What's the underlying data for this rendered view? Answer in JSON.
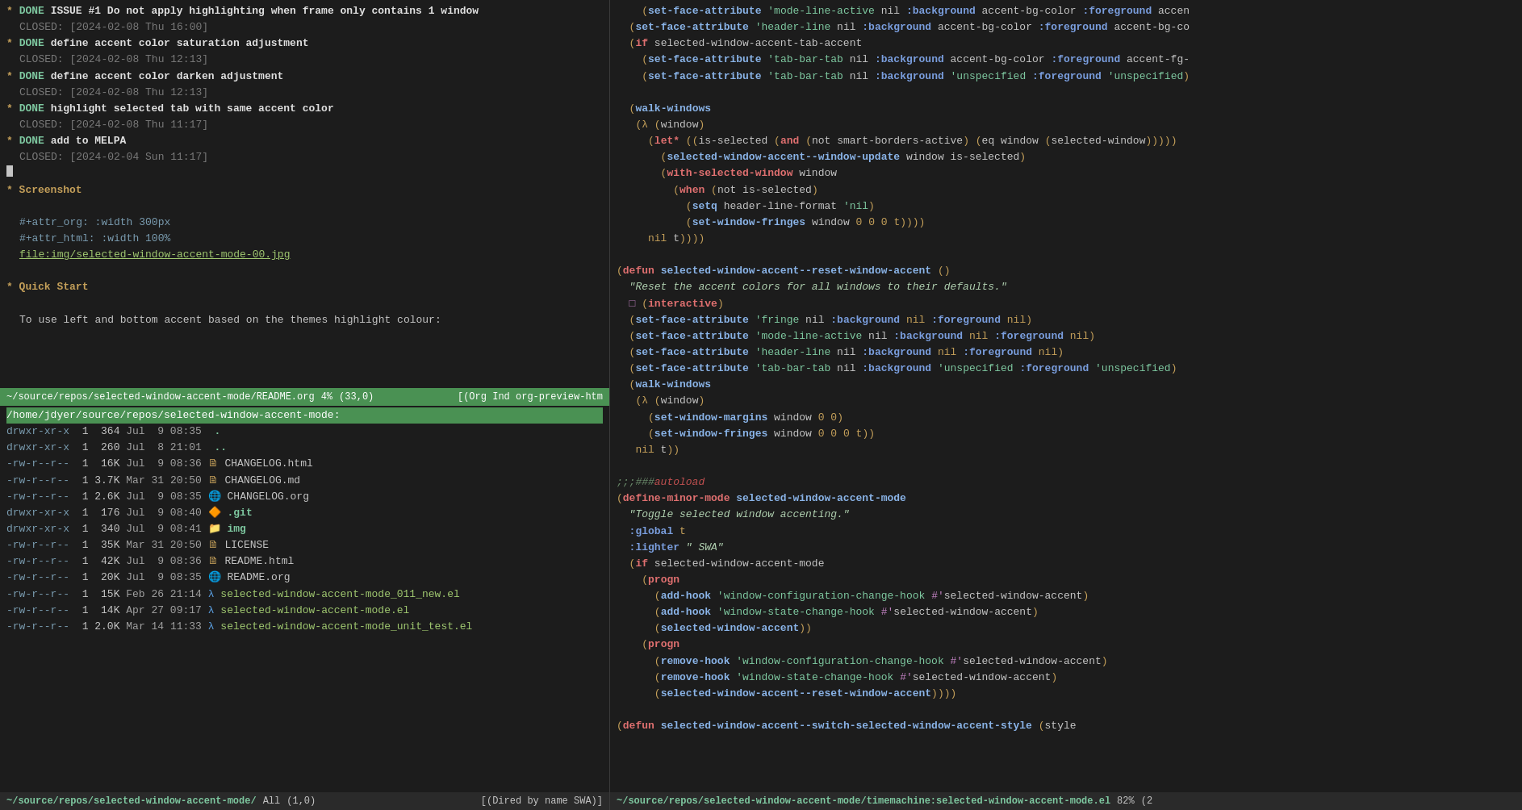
{
  "left_pane": {
    "lines": [
      {
        "type": "todo_done",
        "star": "*",
        "done": "DONE",
        "text": " ISSUE #1 Do not apply highlighting when frame only contains 1 window"
      },
      {
        "type": "closed",
        "text": "  CLOSED: [2024-02-08 Thu 16:00]"
      },
      {
        "type": "todo_done",
        "star": "*",
        "done": "DONE",
        "text": " define accent color saturation adjustment"
      },
      {
        "type": "closed",
        "text": "  CLOSED: [2024-02-08 Thu 12:13]"
      },
      {
        "type": "todo_done",
        "star": "*",
        "done": "DONE",
        "text": " define accent color darken adjustment"
      },
      {
        "type": "closed",
        "text": "  CLOSED: [2024-02-08 Thu 12:13]"
      },
      {
        "type": "todo_done",
        "star": "*",
        "done": "DONE",
        "text": " highlight selected tab with same accent color"
      },
      {
        "type": "closed",
        "text": "  CLOSED: [2024-02-08 Thu 11:17]"
      },
      {
        "type": "todo_done",
        "star": "*",
        "done": "DONE",
        "text": " add to MELPA"
      },
      {
        "type": "closed",
        "text": "  CLOSED: [2024-02-04 Sun 11:17]"
      },
      {
        "type": "cursor"
      },
      {
        "type": "heading",
        "star": "*",
        "text": " Screenshot"
      },
      {
        "type": "blank"
      },
      {
        "type": "attr",
        "text": "  #+attr_org: :width 300px"
      },
      {
        "type": "attr",
        "text": "  #+attr_html: :width 100%"
      },
      {
        "type": "file",
        "text": "  file:img/selected-window-accent-mode-00.jpg"
      },
      {
        "type": "blank"
      },
      {
        "type": "heading",
        "star": "*",
        "text": " Quick Start"
      },
      {
        "type": "blank"
      },
      {
        "type": "text",
        "text": "  To use left and bottom accent based on the themes highlight colour:"
      }
    ],
    "status_bar": {
      "path": "~/source/repos/selected-window-accent-mode/README.org",
      "pct": "4%",
      "pos": "(33,0)",
      "mode": "[(Org Ind org-preview-htm"
    },
    "dired": {
      "path": "/home/jdyer/source/repos/selected-window-accent-mode:",
      "entries": [
        {
          "perms": "drwxr-xr-x",
          "links": "1",
          "size": "364",
          "date": "Jul  9 08:35",
          "icon": "",
          "name": ".",
          "type": "dir"
        },
        {
          "perms": "drwxr-xr-x",
          "links": "1",
          "size": "260",
          "date": "Jul  8 21:01",
          "icon": "",
          "name": "..",
          "type": "dir"
        },
        {
          "perms": "-rw-r--r--",
          "links": "1",
          "size": "16K",
          "date": "Jul  9 08:36",
          "icon": "🗎",
          "name": "CHANGELOG.html",
          "type": "html"
        },
        {
          "perms": "-rw-r--r--",
          "links": "1",
          "size": "3.7K",
          "date": "Mar 31 20:50",
          "icon": "🗎",
          "name": "CHANGELOG.md",
          "type": "md"
        },
        {
          "perms": "-rw-r--r--",
          "links": "1",
          "size": "2.6K",
          "date": "Jul  9 08:35",
          "icon": "🌐",
          "name": "CHANGELOG.org",
          "type": "org"
        },
        {
          "perms": "drwxr-xr-x",
          "links": "1",
          "size": "176",
          "date": "Jul  9 08:40",
          "icon": "🔶",
          "name": ".git",
          "type": "git"
        },
        {
          "perms": "drwxr-xr-x",
          "links": "1",
          "size": "340",
          "date": "Jul  9 08:41",
          "icon": "📁",
          "name": "img",
          "type": "imgdir"
        },
        {
          "perms": "-rw-r--r--",
          "links": "1",
          "size": "35K",
          "date": "Mar 31 20:50",
          "icon": "🗎",
          "name": "LICENSE",
          "type": "file"
        },
        {
          "perms": "-rw-r--r--",
          "links": "1",
          "size": "42K",
          "date": "Jul  9 08:36",
          "icon": "🗎",
          "name": "README.html",
          "type": "html"
        },
        {
          "perms": "-rw-r--r--",
          "links": "1",
          "size": "20K",
          "date": "Jul  9 08:35",
          "icon": "🌐",
          "name": "README.org",
          "type": "org"
        },
        {
          "perms": "-rw-r--r--",
          "links": "1",
          "size": "15K",
          "date": "Feb 26 21:14",
          "icon": "λ",
          "name": "selected-window-accent-mode_011_new.el",
          "type": "el"
        },
        {
          "perms": "-rw-r--r--",
          "links": "1",
          "size": "14K",
          "date": "Apr 27 09:17",
          "icon": "λ",
          "name": "selected-window-accent-mode.el",
          "type": "el"
        },
        {
          "perms": "-rw-r--r--",
          "links": "1",
          "size": "2.0K",
          "date": "Mar 14 11:33",
          "icon": "λ",
          "name": "selected-window-accent-mode_unit_test.el",
          "type": "el"
        }
      ]
    },
    "dired_status": {
      "path": "~/source/repos/selected-window-accent-mode/",
      "count": "All",
      "pos": "(1,0)",
      "mode": "[(Dired by name SWA)]"
    }
  },
  "right_pane": {
    "status_bar": {
      "path": "~/source/repos/selected-window-accent-mode/timemachine:selected-window-accent-mode.el",
      "pct": "82%",
      "pos": "(2"
    }
  }
}
